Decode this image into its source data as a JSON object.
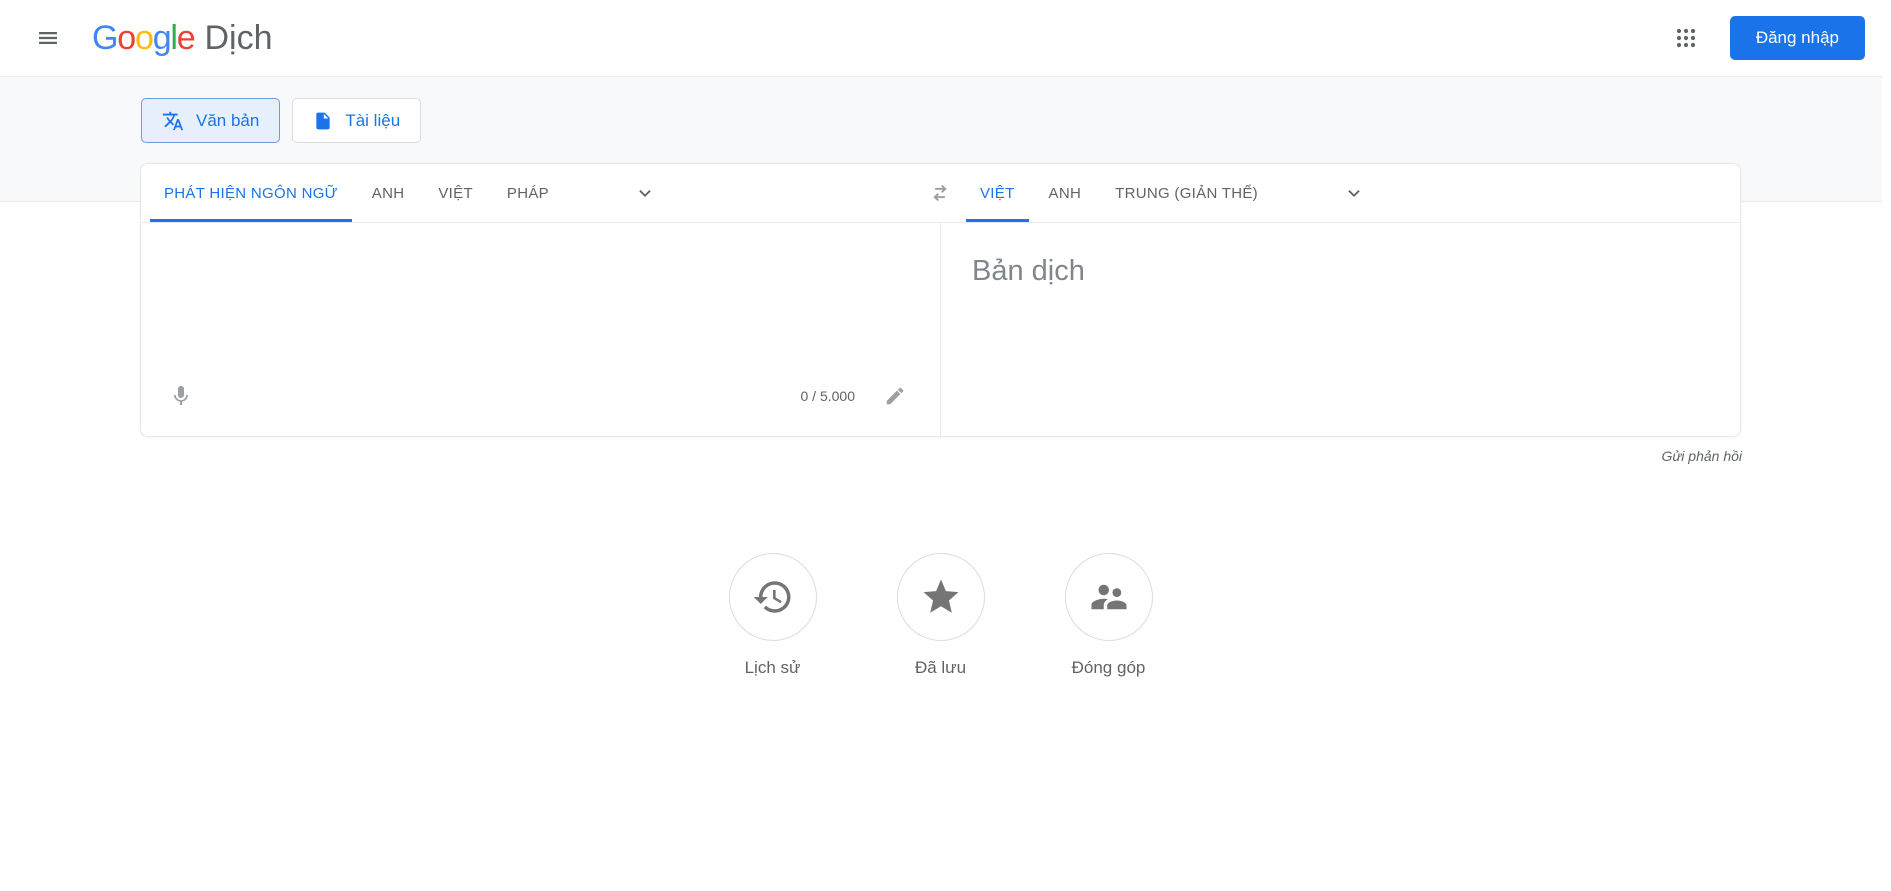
{
  "colors": {
    "accent": "#1a73e8",
    "text_gray": "#5f6368",
    "placeholder_gray": "#80868b",
    "icon_gray": "#9aa0a6",
    "band_bg": "#f8f9fa"
  },
  "header": {
    "logo_letters": [
      {
        "ch": "G",
        "color": "#4285F4"
      },
      {
        "ch": "o",
        "color": "#EA4335"
      },
      {
        "ch": "o",
        "color": "#FBBC05"
      },
      {
        "ch": "g",
        "color": "#4285F4"
      },
      {
        "ch": "l",
        "color": "#34A853"
      },
      {
        "ch": "e",
        "color": "#EA4335"
      }
    ],
    "logo_product": "Dịch",
    "menu_icon": "hamburger-menu-icon",
    "apps_icon": "apps-grid-icon",
    "signin_label": "Đăng nhập"
  },
  "mode_tabs": {
    "text": {
      "label": "Văn bản",
      "icon": "translate-icon",
      "active": true
    },
    "document": {
      "label": "Tài liệu",
      "icon": "document-icon",
      "active": false
    }
  },
  "translator": {
    "source_tabs": [
      {
        "label": "PHÁT HIỆN NGÔN NGỮ",
        "active": true
      },
      {
        "label": "ANH",
        "active": false
      },
      {
        "label": "VIỆT",
        "active": false
      },
      {
        "label": "PHÁP",
        "active": false
      }
    ],
    "target_tabs": [
      {
        "label": "VIỆT",
        "active": true
      },
      {
        "label": "ANH",
        "active": false
      },
      {
        "label": "TRUNG (GIẢN THỂ)",
        "active": false
      }
    ],
    "swap_icon": "swap-languages-icon",
    "input": {
      "char_counter": "0 / 5.000",
      "mic_icon": "microphone-icon",
      "edit_icon": "pencil-icon"
    },
    "output": {
      "placeholder": "Bản dịch"
    }
  },
  "feedback_label": "Gửi phản hồi",
  "shortcuts": [
    {
      "label": "Lịch sử",
      "icon": "history-icon"
    },
    {
      "label": "Đã lưu",
      "icon": "star-icon"
    },
    {
      "label": "Đóng góp",
      "icon": "contribute-icon"
    }
  ]
}
